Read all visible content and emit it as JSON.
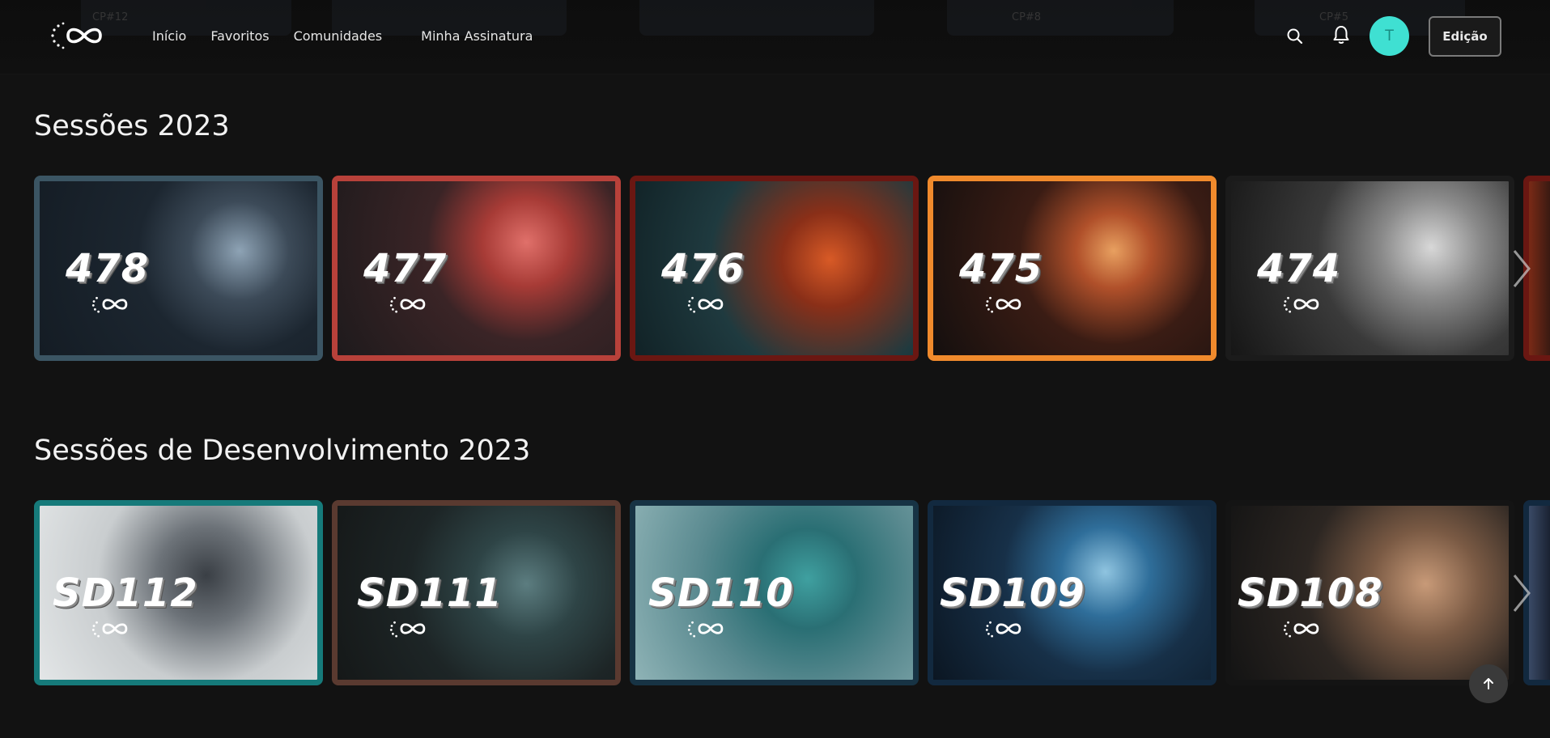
{
  "nav": {
    "items": [
      "Início",
      "Favoritos",
      "Comunidades",
      "Minha Assinatura"
    ]
  },
  "header": {
    "avatar_initial": "T",
    "edit_label": "Edição",
    "ghost_labels": [
      "CP#12",
      "CP#8",
      "CP#5"
    ]
  },
  "sections": [
    {
      "title": "Sessões 2023",
      "cards": [
        {
          "label": "478",
          "border": "#3b5563"
        },
        {
          "label": "477",
          "border": "#b8413a"
        },
        {
          "label": "476",
          "border": "#6a1712"
        },
        {
          "label": "475",
          "border": "#f08a2c"
        },
        {
          "label": "474",
          "border": "#1b1b1b"
        }
      ]
    },
    {
      "title": "Sessões de Desenvolvimento 2023",
      "cards": [
        {
          "label": "SD112",
          "border": "#167a7a"
        },
        {
          "label": "SD111",
          "border": "#5a3a30"
        },
        {
          "label": "SD110",
          "border": "#173344"
        },
        {
          "label": "SD109",
          "border": "#12293f"
        },
        {
          "label": "SD108",
          "border": "#141414"
        }
      ]
    }
  ],
  "colors": {
    "background": "#121212",
    "avatar": "#3fe0d2",
    "accent_orange": "#f08a2c"
  },
  "icons": [
    "logo-infinity-icon",
    "search-icon",
    "bell-icon",
    "chevron-right-icon",
    "arrow-up-icon"
  ]
}
